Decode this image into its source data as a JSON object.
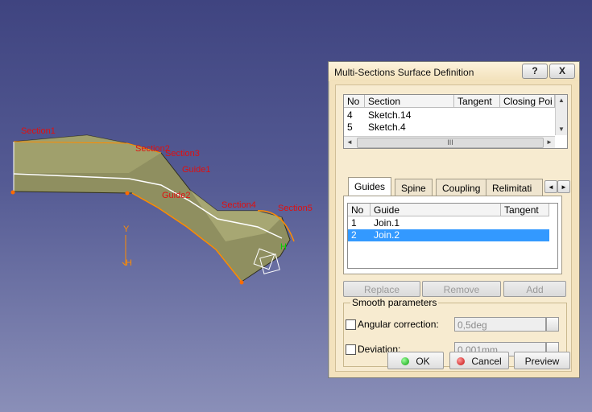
{
  "viewport": {
    "labels": {
      "section1": "Section1",
      "section2": "Section2",
      "section3": "Section3",
      "section4": "Section4",
      "section5": "Section5",
      "guide1": "Guide1",
      "guide2": "Guide2"
    },
    "axis": {
      "y": "Y",
      "h": "H"
    }
  },
  "dialog": {
    "title": "Multi-Sections Surface Definition",
    "title_buttons": {
      "help": "?",
      "close": "X"
    },
    "sections_table": {
      "headers": [
        "No",
        "Section",
        "Tangent",
        "Closing Poi"
      ],
      "rows": [
        {
          "no": "4",
          "section": "Sketch.14"
        },
        {
          "no": "5",
          "section": "Sketch.4"
        }
      ],
      "scroll_grip": "III"
    },
    "tabs": [
      "Guides",
      "Spine",
      "Coupling",
      "Relimitati"
    ],
    "tab_nav": {
      "prev": "◄",
      "next": "►"
    },
    "guides_table": {
      "headers": [
        "No",
        "Guide",
        "Tangent"
      ],
      "rows": [
        {
          "no": "1",
          "guide": "Join.1"
        },
        {
          "no": "2",
          "guide": "Join.2"
        }
      ]
    },
    "actions": {
      "replace": "Replace",
      "remove": "Remove",
      "add": "Add"
    },
    "smooth": {
      "label": "Smooth parameters",
      "angular_label": "Angular correction:",
      "angular_value": "0,5deg",
      "deviation_label": "Deviation:",
      "deviation_value": "0,001mm"
    },
    "footer": {
      "ok": "OK",
      "cancel": "Cancel",
      "preview": "Preview"
    }
  },
  "colors": {
    "surface": "#8a8a5c",
    "label": "#e01010",
    "wire": "#ff8c00",
    "selected_row": "#3399ff"
  }
}
